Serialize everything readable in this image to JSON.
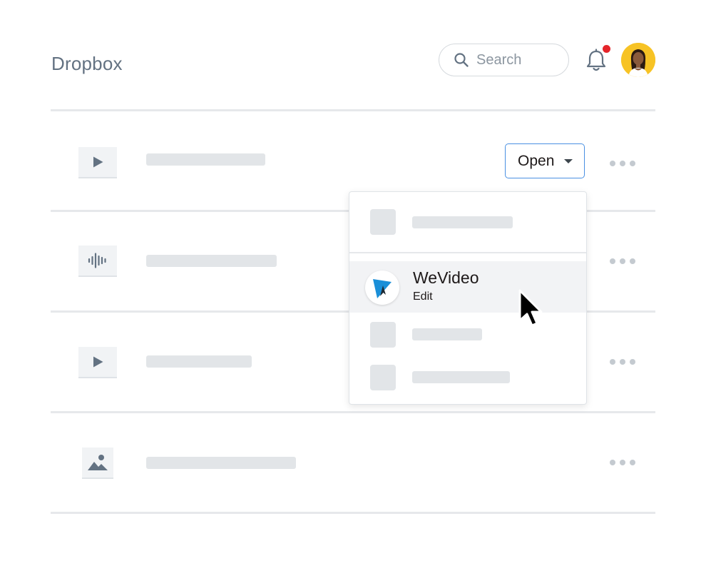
{
  "app": {
    "title": "Dropbox"
  },
  "header": {
    "search": {
      "placeholder": "Search",
      "icon": "search-icon"
    },
    "notifications": {
      "icon": "bell-icon",
      "has_unread": true
    },
    "avatar": {
      "icon": "user-avatar"
    }
  },
  "file_list": {
    "rows": [
      {
        "type": "video",
        "icon": "play-icon",
        "has_open_button": true
      },
      {
        "type": "audio",
        "icon": "audio-waveform-icon"
      },
      {
        "type": "video",
        "icon": "play-icon"
      },
      {
        "type": "image",
        "icon": "image-icon"
      }
    ]
  },
  "open_button": {
    "label": "Open",
    "icon": "caret-down-icon"
  },
  "open_menu": {
    "items": [
      {
        "placeholder": true
      },
      {
        "app_name": "WeVideo",
        "action": "Edit",
        "icon": "wevideo-logo-icon",
        "hovered": true
      },
      {
        "placeholder": true
      },
      {
        "placeholder": true
      }
    ]
  },
  "colors": {
    "accent": "#4a90e2",
    "notification_dot": "#e5252a",
    "avatar_bg": "#f7c325",
    "wevideo_blue": "#1a8fd8"
  }
}
